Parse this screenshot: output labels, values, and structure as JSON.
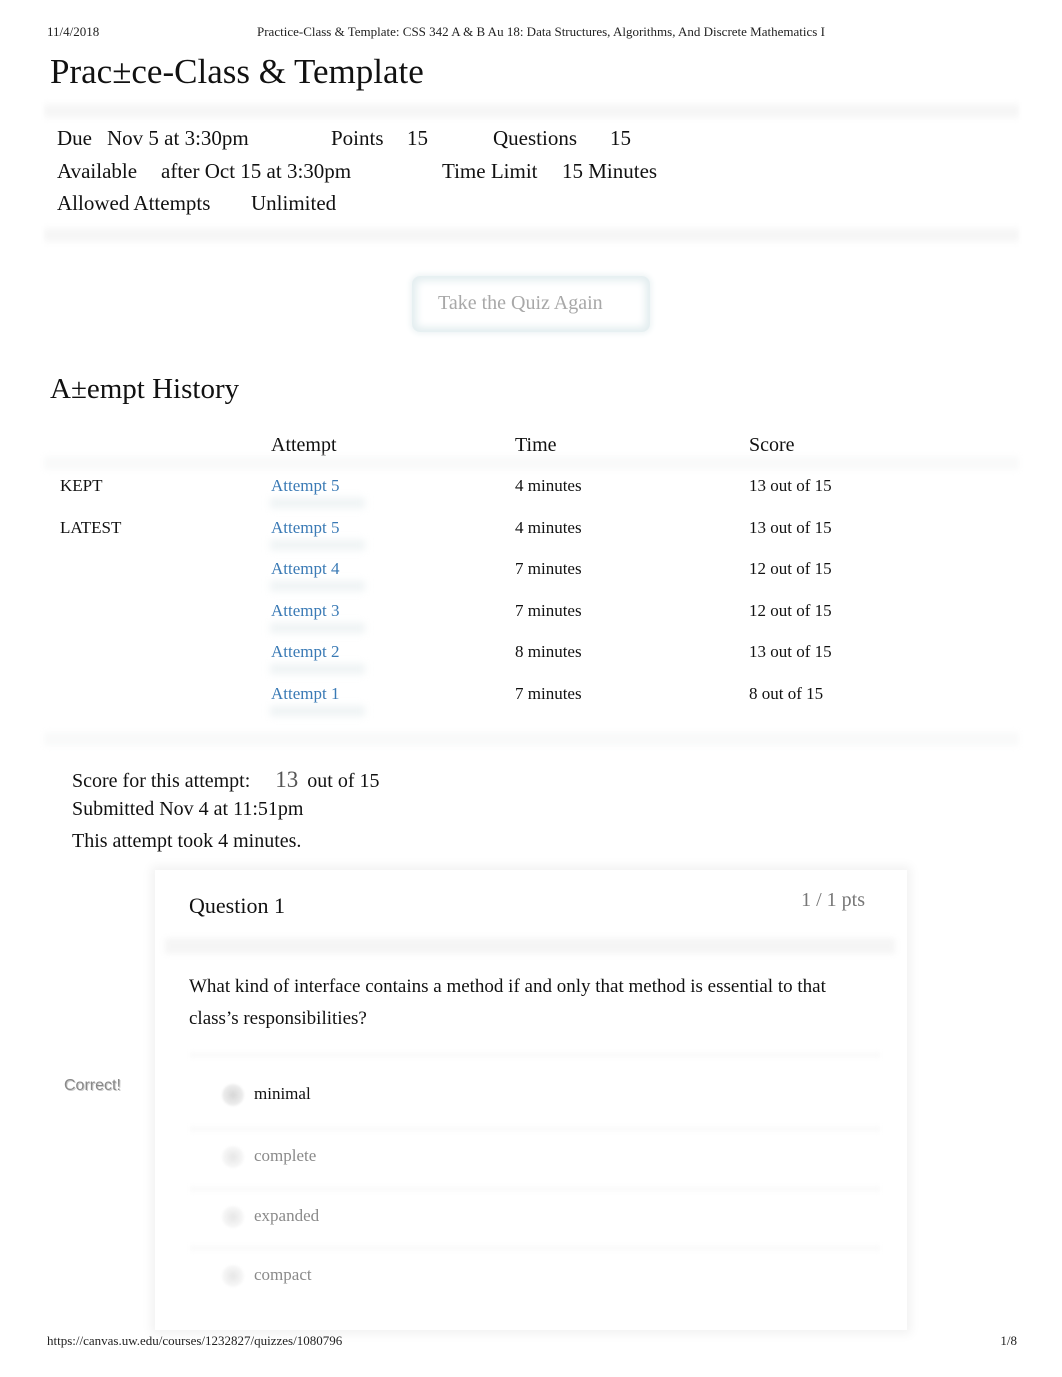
{
  "print_header": {
    "date": "11/4/2018",
    "title": "Practice-Class & Template: CSS 342 A & B Au 18: Data Structures, Algorithms, And Discrete Mathematics I"
  },
  "page_title": "Prac±ce-Class & Template",
  "details": {
    "due_label": "Due",
    "due_value": "Nov 5 at 3:30pm",
    "points_label": "Points",
    "points_value": "15",
    "questions_label": "Questions",
    "questions_value": "15",
    "available_label": "Available",
    "available_value": "after Oct 15 at 3:30pm",
    "time_limit_label": "Time Limit",
    "time_limit_value": "15 Minutes",
    "allowed_attempts_label": "Allowed Attempts",
    "allowed_attempts_value": "Unlimited"
  },
  "take_quiz_button": "Take the Quiz Again",
  "attempt_history": {
    "title": "A±empt History",
    "columns": [
      "",
      "Attempt",
      "Time",
      "Score"
    ],
    "rows": [
      {
        "tag": "KEPT",
        "attempt": "Attempt 5",
        "time": "4 minutes",
        "score": "13 out of 15"
      },
      {
        "tag": "LATEST",
        "attempt": "Attempt 5",
        "time": "4 minutes",
        "score": "13 out of 15"
      },
      {
        "tag": "",
        "attempt": "Attempt 4",
        "time": "7 minutes",
        "score": "12 out of 15"
      },
      {
        "tag": "",
        "attempt": "Attempt 3",
        "time": "7 minutes",
        "score": "12 out of 15"
      },
      {
        "tag": "",
        "attempt": "Attempt 2",
        "time": "8 minutes",
        "score": "13 out of 15"
      },
      {
        "tag": "",
        "attempt": "Attempt 1",
        "time": "7 minutes",
        "score": "8 out of 15"
      }
    ]
  },
  "summary": {
    "score_label": "Score for this attempt:",
    "score_value": "13",
    "score_total": "out of 15",
    "submitted": "Submitted Nov 4 at 11:51pm",
    "duration": "This attempt took 4 minutes."
  },
  "question": {
    "title": "Question 1",
    "points": "1 / 1 pts",
    "text": "What kind of interface contains a method if and only that method is essential to that class’s responsibilities?",
    "result_label": "Correct!",
    "answers": [
      {
        "label": "minimal",
        "selected": true
      },
      {
        "label": "complete",
        "selected": false
      },
      {
        "label": "expanded",
        "selected": false
      },
      {
        "label": "compact",
        "selected": false
      }
    ]
  },
  "print_footer": {
    "url": "https://canvas.uw.edu/courses/1232827/quizzes/1080796",
    "page": "1/8"
  },
  "colors": {
    "link": "#3a7ab5",
    "muted_text": "#8a8a8a"
  }
}
